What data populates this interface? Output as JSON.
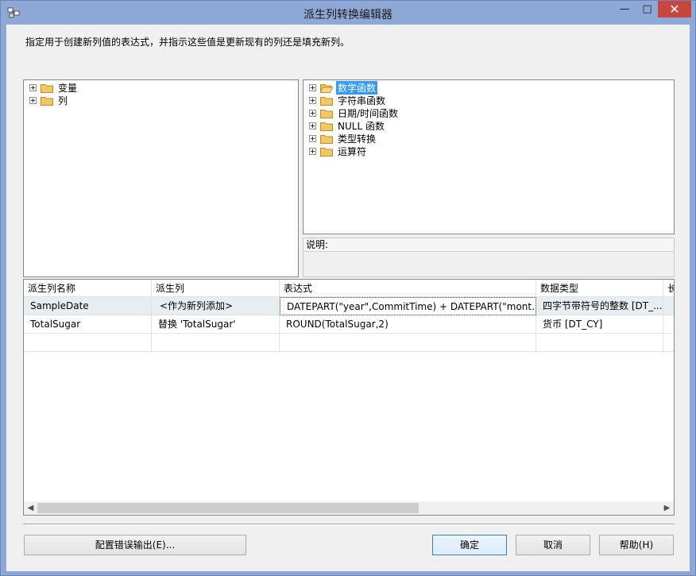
{
  "window": {
    "title": "派生列转换编辑器",
    "controls": {
      "minimize": "—",
      "maximize": "□",
      "close": "✕"
    }
  },
  "description": "指定用于创建新列值的表达式，并指示这些值是更新现有的列还是填充新列。",
  "left_tree": [
    {
      "label": "变量"
    },
    {
      "label": "列"
    }
  ],
  "right_tree": [
    {
      "label": "数学函数",
      "selected": true
    },
    {
      "label": "字符串函数"
    },
    {
      "label": "日期/时间函数"
    },
    {
      "label": "NULL 函数"
    },
    {
      "label": "类型转换"
    },
    {
      "label": "运算符"
    }
  ],
  "help": {
    "label": "说明:"
  },
  "grid": {
    "headers": [
      "派生列名称",
      "派生列",
      "表达式",
      "数据类型",
      "长"
    ],
    "rows": [
      [
        "SampleDate",
        "<作为新列添加>",
        "DATEPART(\"year\",CommitTime) + DATEPART(\"mont...",
        "四字节带符号的整数 [DT_..."
      ],
      [
        "TotalSugar",
        "替换 'TotalSugar'",
        "ROUND(TotalSugar,2)",
        "货币 [DT_CY]"
      ]
    ]
  },
  "buttons": {
    "config_error": "配置错误输出(E)...",
    "ok": "确定",
    "cancel": "取消",
    "help": "帮助(H)"
  },
  "colors": {
    "titlebar": "#8ea8d6",
    "selection": "#3399ff",
    "close": "#c7463e"
  }
}
